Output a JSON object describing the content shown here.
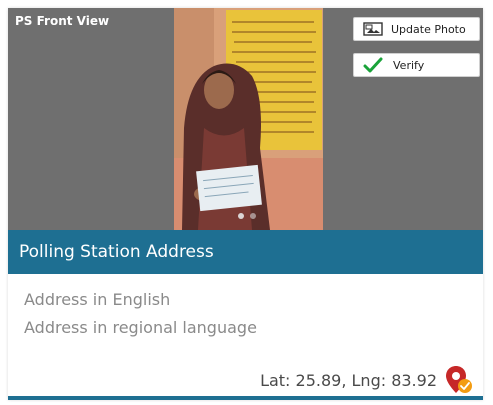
{
  "photo_section": {
    "title": "PS Front View",
    "update_photo_label": "Update Photo",
    "verify_label": "Verify",
    "carousel_dots": 2
  },
  "address": {
    "header": "Polling Station Address",
    "english_placeholder": "Address in English",
    "regional_placeholder": "Address in regional language",
    "coordinates": "Lat: 25.89, Lng: 83.92"
  },
  "colors": {
    "header_bg": "#1e6f92",
    "photo_bg": "#6f6f6f",
    "verify_check": "#1aa33a",
    "map_pin": "#c62828",
    "map_badge": "#f39c12"
  },
  "icons": {
    "update_photo": "image-icon",
    "verify": "check-icon",
    "map": "map-pin-icon"
  }
}
